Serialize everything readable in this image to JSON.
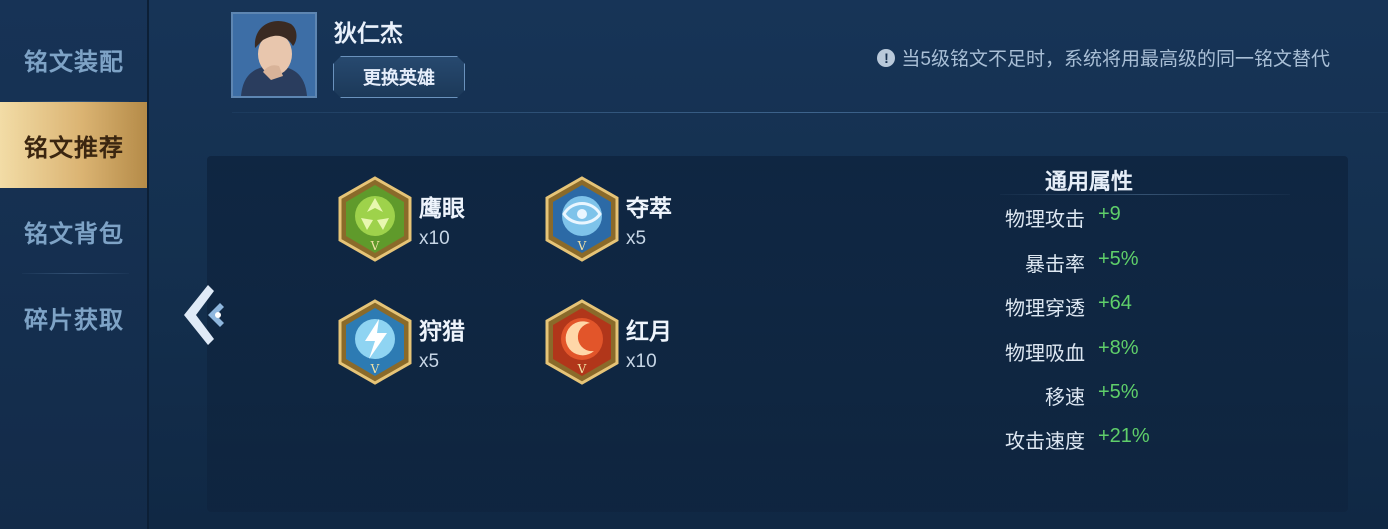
{
  "sidebar": {
    "items": [
      {
        "label": "铭文装配",
        "active": false
      },
      {
        "label": "铭文推荐",
        "active": true
      },
      {
        "label": "铭文背包",
        "active": false
      },
      {
        "label": "碎片获取",
        "active": false
      }
    ]
  },
  "hero": {
    "name": "狄仁杰",
    "change_button": "更换英雄"
  },
  "notice": {
    "icon": "info-icon",
    "text": "当5级铭文不足时，系统将用最高级的同一铭文替代"
  },
  "runes": [
    {
      "name": "鹰眼",
      "count": "x10",
      "icon": "rune-green-icon",
      "tier": "V"
    },
    {
      "name": "夺萃",
      "count": "x5",
      "icon": "rune-blue-icon",
      "tier": "V"
    },
    {
      "name": "狩猎",
      "count": "x5",
      "icon": "rune-blue-lightning-icon",
      "tier": "V"
    },
    {
      "name": "红月",
      "count": "x10",
      "icon": "rune-red-icon",
      "tier": "V"
    }
  ],
  "stats": {
    "title": "通用属性",
    "rows": [
      {
        "label": "物理攻击",
        "value": "+9"
      },
      {
        "label": "暴击率",
        "value": "+5%"
      },
      {
        "label": "物理穿透",
        "value": "+64"
      },
      {
        "label": "物理吸血",
        "value": "+8%"
      },
      {
        "label": "移速",
        "value": "+5%"
      },
      {
        "label": "攻击速度",
        "value": "+21%"
      }
    ]
  },
  "colors": {
    "accent_gold": "#dbb473",
    "stat_green": "#5fcf6a",
    "background": "#173457"
  }
}
